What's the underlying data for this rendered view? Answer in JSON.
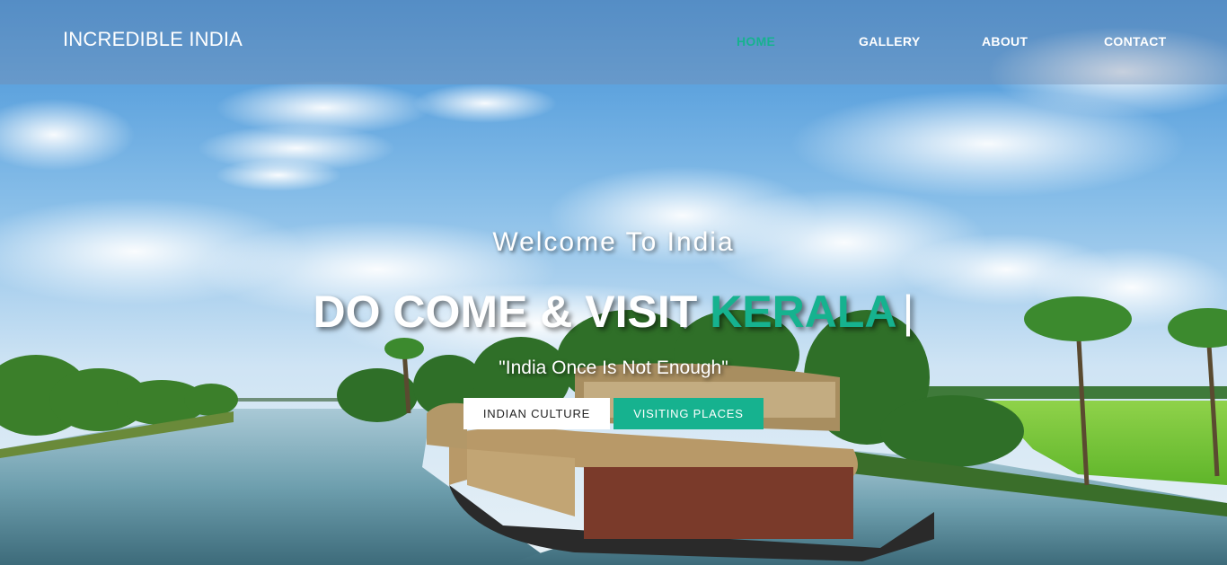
{
  "brand": "INCREDIBLE INDIA",
  "nav": {
    "home": "HOME",
    "gallery": "GALLERY",
    "about": "ABOUT",
    "contact": "CONTACT",
    "active_item": "home"
  },
  "hero": {
    "welcome": "Welcome To India",
    "headline_prefix": "DO COME & VISIT ",
    "headline_highlight": "KERALA",
    "headline_cursor": "|",
    "tagline": "\"India Once Is Not Enough\""
  },
  "buttons": {
    "culture": "INDIAN CULTURE",
    "places": "VISITING PLACES"
  },
  "colors": {
    "accent": "#16b28f",
    "navbar_bg": "rgba(120, 140, 170, 0.38)",
    "text_light": "#ffffff"
  },
  "background_image": "kerala-backwaters-houseboat"
}
